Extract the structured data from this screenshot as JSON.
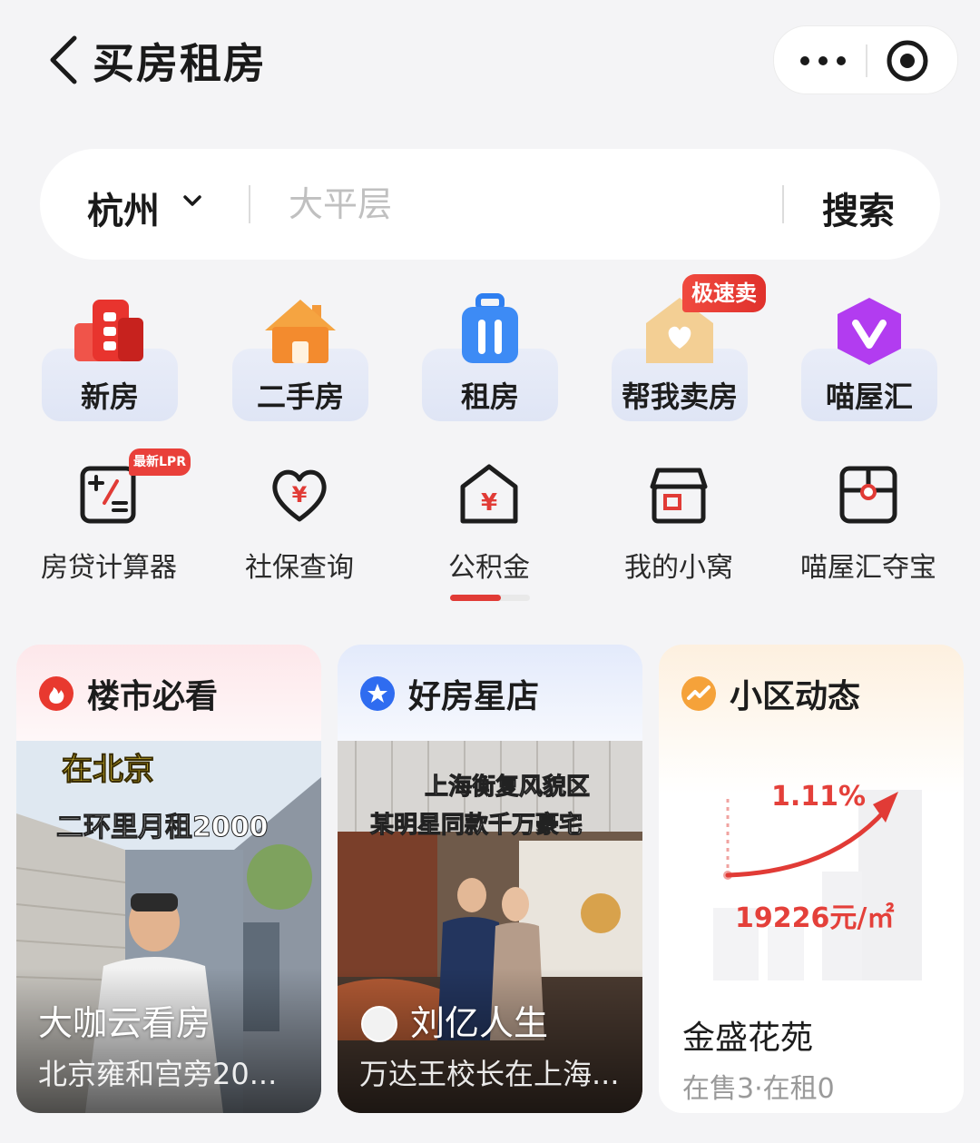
{
  "header": {
    "title": "买房租房"
  },
  "search": {
    "city": "杭州",
    "placeholder": "大平层",
    "button": "搜索"
  },
  "categories": [
    {
      "label": "新房",
      "icon": "building-icon"
    },
    {
      "label": "二手房",
      "icon": "house-icon"
    },
    {
      "label": "租房",
      "icon": "luggage-icon"
    },
    {
      "label": "帮我卖房",
      "icon": "heart-house-icon",
      "badge": "极速卖"
    },
    {
      "label": "喵屋汇",
      "icon": "v-badge-icon"
    }
  ],
  "tools": [
    {
      "label": "房贷计算器",
      "icon": "calculator-icon",
      "badge": "最新LPR"
    },
    {
      "label": "社保查询",
      "icon": "heart-yuan-icon"
    },
    {
      "label": "公积金",
      "icon": "house-yuan-icon"
    },
    {
      "label": "我的小窝",
      "icon": "store-icon"
    },
    {
      "label": "喵屋汇夺宝",
      "icon": "treasure-box-icon"
    }
  ],
  "cards": [
    {
      "title": "楼市必看",
      "icon": "fire-icon",
      "media_caption_1": "在北京",
      "media_caption_2": "二环里月租2000",
      "overlay_title": "大咖云看房",
      "overlay_sub": "北京雍和宫旁20..."
    },
    {
      "title": "好房星店",
      "icon": "star-icon",
      "media_caption_1": "上海衡复风貌区",
      "media_caption_2": "某明星同款千万豪宅",
      "overlay_title": "刘亿人生",
      "overlay_sub": "万达王校长在上海..."
    },
    {
      "title": "小区动态",
      "icon": "trend-icon",
      "change": "1.11%",
      "price": "19226元/㎡",
      "community": "金盛花苑",
      "stats": "在售3·在租0"
    }
  ],
  "colors": {
    "accent": "#e13b36",
    "background": "#f4f4f6"
  }
}
